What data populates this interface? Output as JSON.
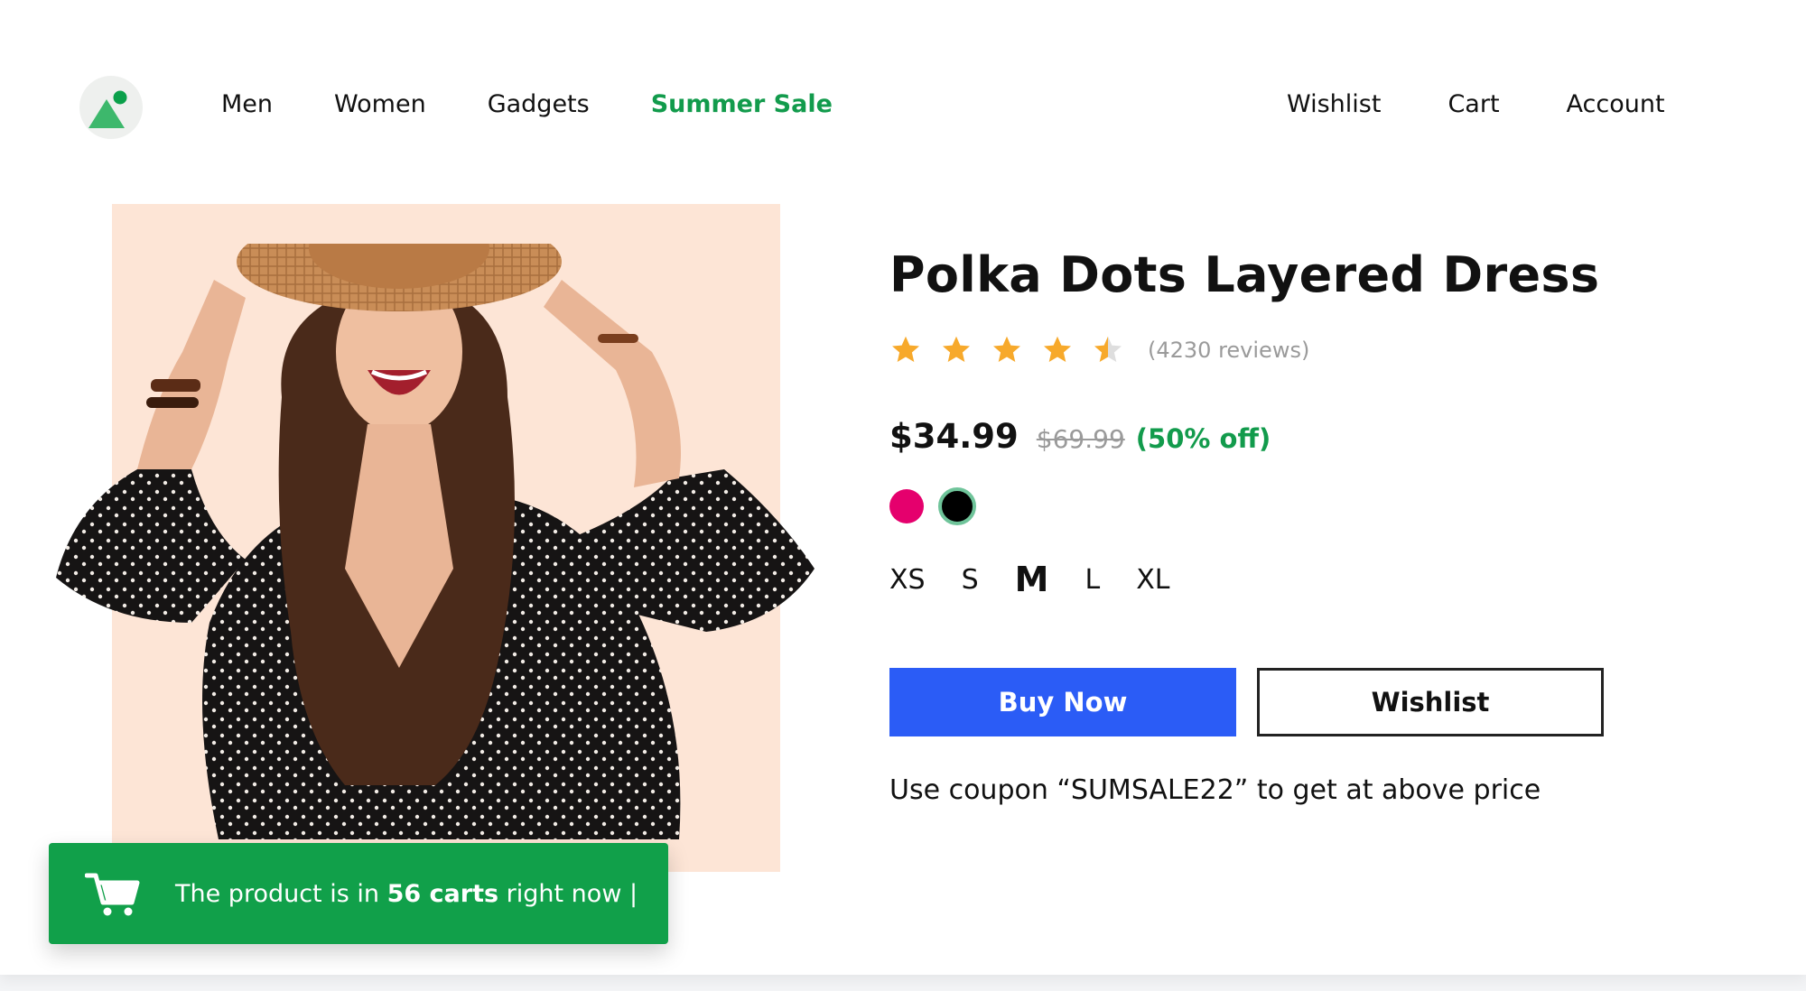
{
  "header": {
    "nav_left": [
      "Men",
      "Women",
      "Gadgets"
    ],
    "sale_link": "Summer Sale",
    "nav_right": [
      "Wishlist",
      "Cart",
      "Account"
    ]
  },
  "product": {
    "title": "Polka Dots Layered Dress",
    "rating": 4.5,
    "reviews": "(4230 reviews)",
    "price": "$34.99",
    "old_price": "$69.99",
    "discount": "(50% off)",
    "colors": [
      "#e5006d",
      "#000000"
    ],
    "selected_color": "#000000",
    "sizes": [
      "XS",
      "S",
      "M",
      "L",
      "XL"
    ],
    "selected_size": "M",
    "buy_label": "Buy Now",
    "wishlist_label": "Wishlist",
    "coupon_text": "Use coupon “SUMSALE22” to get at above price"
  },
  "toast": {
    "prefix": "The product is in ",
    "count": "56 carts",
    "suffix": " right now |"
  },
  "colors": {
    "accent_green": "#129b4c",
    "toast_green": "#11a04a",
    "buy_blue": "#2b5cf6",
    "photo_bg": "#fde5d6",
    "star": "#f7a92b"
  },
  "icons": {
    "logo": "brand-logo",
    "cart": "cart-icon",
    "star": "star-icon"
  }
}
